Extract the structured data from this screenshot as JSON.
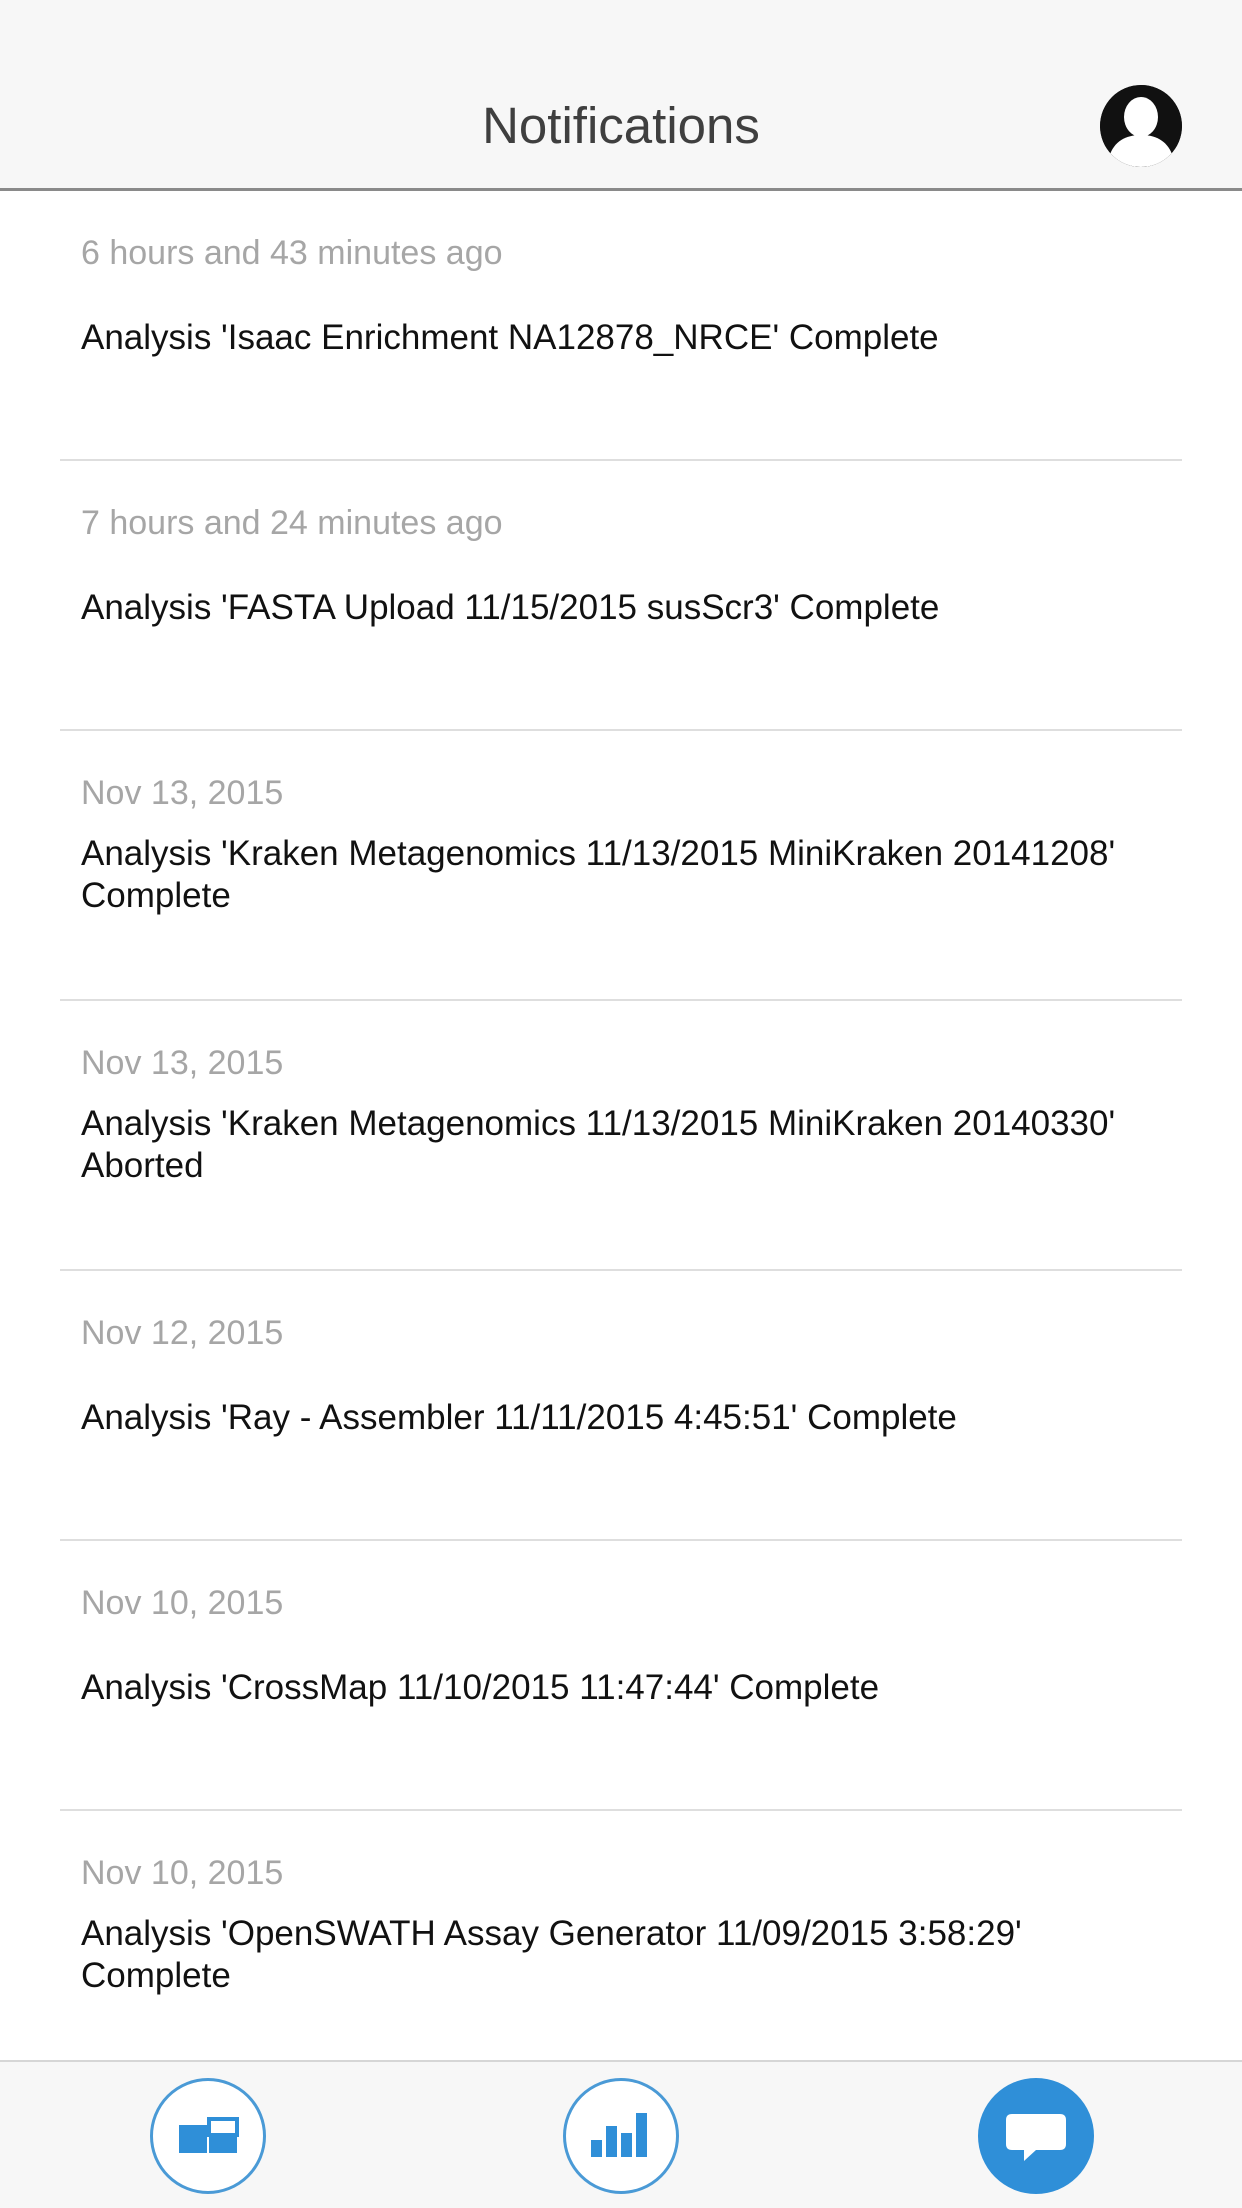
{
  "header": {
    "title": "Notifications",
    "profile_icon": "user-silhouette-icon"
  },
  "notifications": [
    {
      "time": "6 hours and 43 minutes ago",
      "message": "Analysis 'Isaac Enrichment NA12878_NRCE' Complete"
    },
    {
      "time": "7 hours and 24 minutes ago",
      "message": "Analysis 'FASTA Upload 11/15/2015 susScr3' Complete"
    },
    {
      "time": "Nov 13, 2015",
      "message": "Analysis 'Kraken Metagenomics 11/13/2015 MiniKraken 20141208' Complete"
    },
    {
      "time": "Nov 13, 2015",
      "message": "Analysis 'Kraken Metagenomics 11/13/2015 MiniKraken 20140330' Aborted"
    },
    {
      "time": "Nov 12, 2015",
      "message": "Analysis 'Ray - Assembler 11/11/2015 4:45:51' Complete"
    },
    {
      "time": "Nov 10, 2015",
      "message": "Analysis 'CrossMap 11/10/2015 11:47:44' Complete"
    },
    {
      "time": "Nov 10, 2015",
      "message": "Analysis 'OpenSWATH Assay Generator 11/09/2015 3:58:29' Complete"
    }
  ],
  "tabbar": {
    "tabs": [
      {
        "icon": "projects-icon",
        "active": false
      },
      {
        "icon": "bar-chart-icon",
        "active": false
      },
      {
        "icon": "chat-bubble-icon",
        "active": true
      }
    ]
  },
  "colors": {
    "accent": "#2f8fd8",
    "outline": "#4a9ad6",
    "timestamp": "#a6a6a6",
    "header_bg": "#f7f7f7"
  }
}
